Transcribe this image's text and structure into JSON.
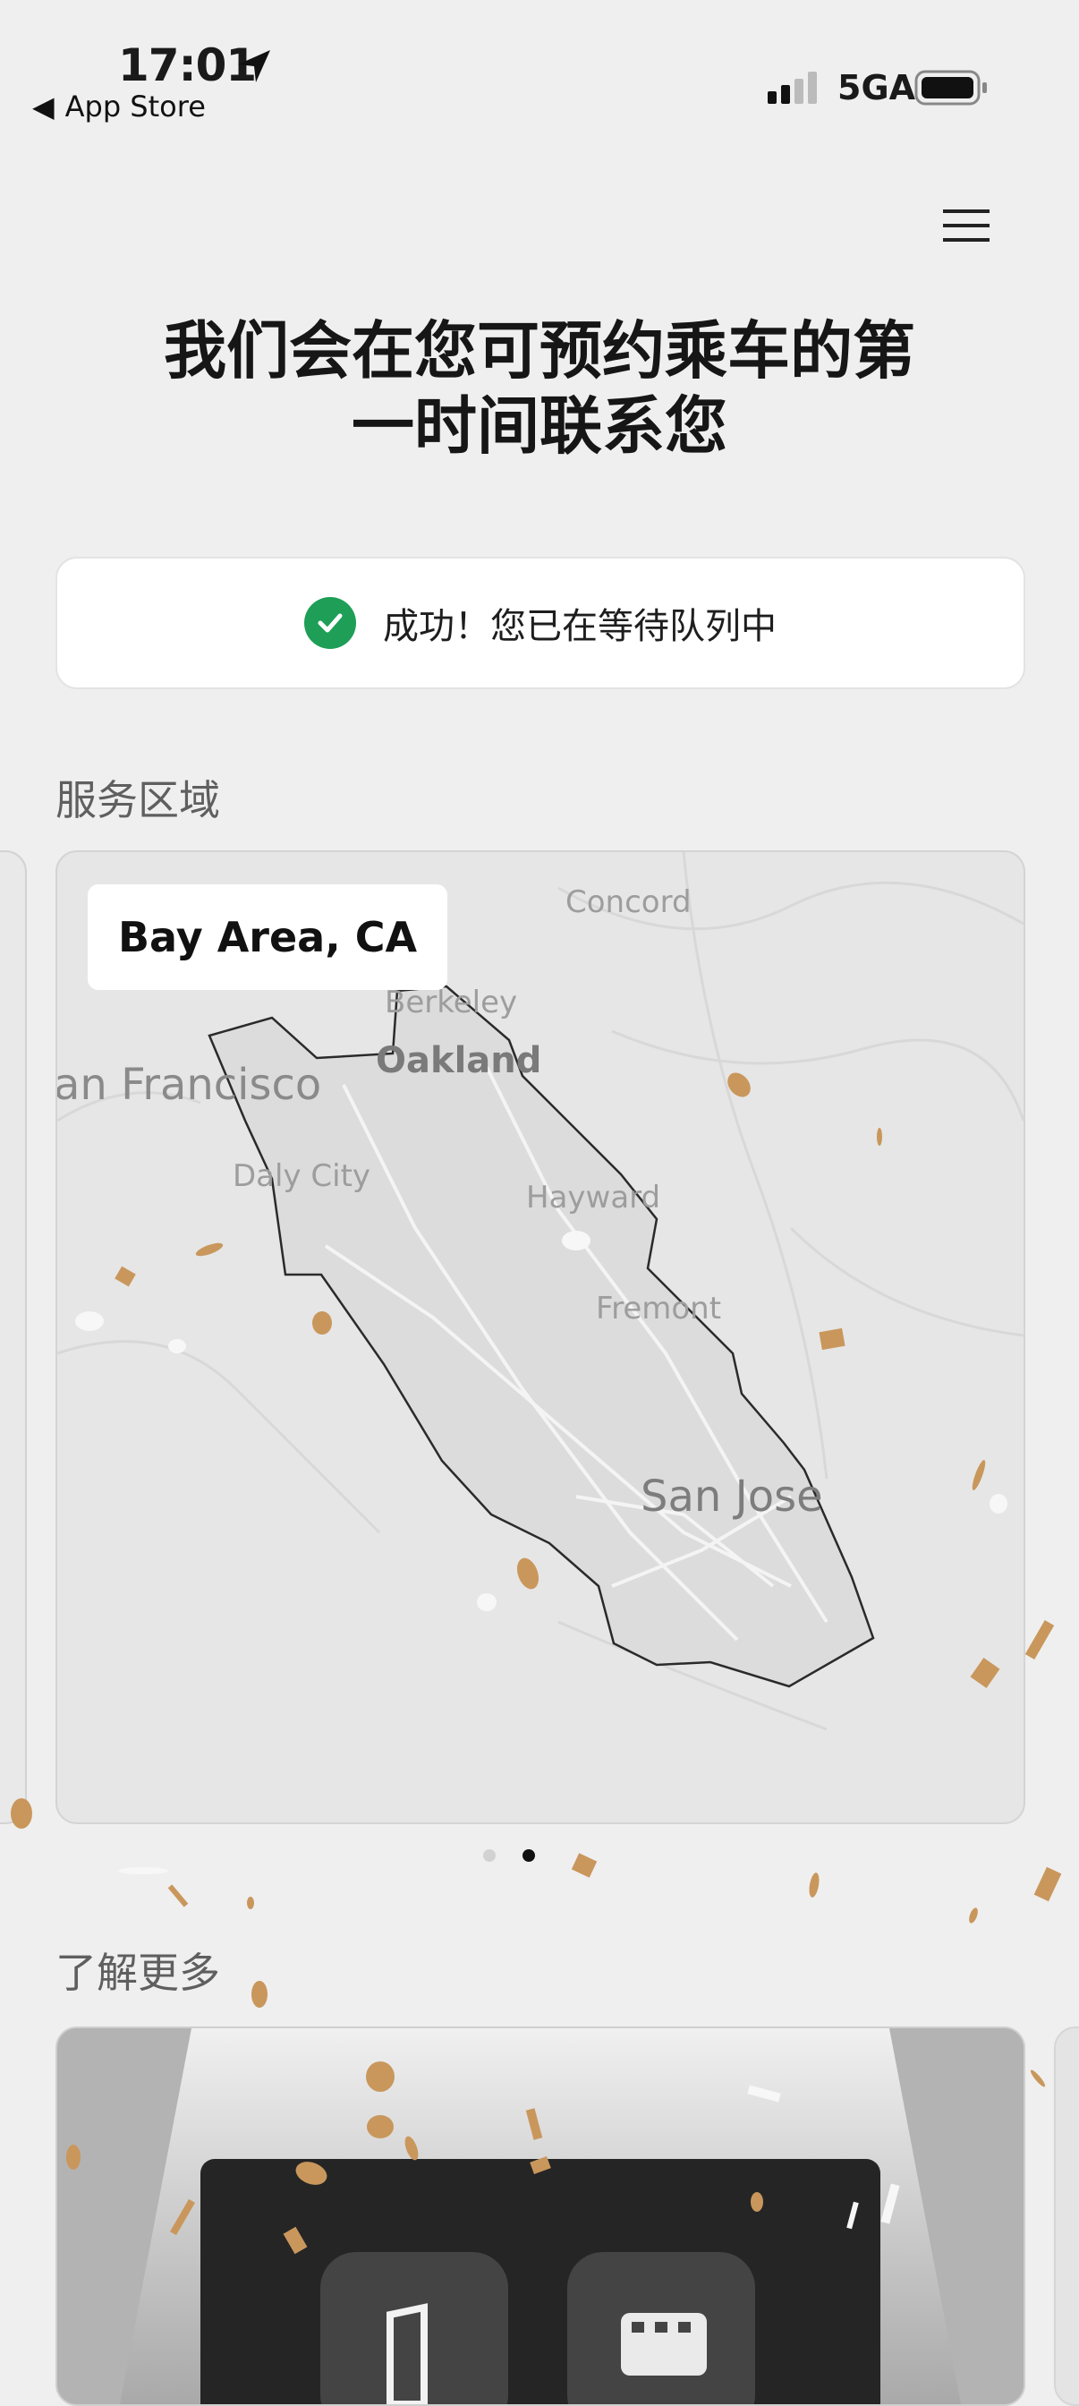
{
  "status_bar": {
    "time": "17:01",
    "back_label": "App Store",
    "network": "5GA"
  },
  "header": {
    "title_line1": "我们会在您可预约乘车的第",
    "title_line2": "一时间联系您"
  },
  "banner": {
    "message": "成功！您已在等待队列中",
    "status_color": "#1e9e57"
  },
  "service_area": {
    "section_title": "服务区域",
    "region_label": "Bay Area, CA",
    "cities": [
      "Concord",
      "Berkeley",
      "Oakland",
      "an Francisco",
      "Daly City",
      "Hayward",
      "Fremont",
      "San Jose"
    ],
    "pagination": {
      "total": 2,
      "active_index": 1
    }
  },
  "learn_more": {
    "section_title": "了解更多"
  }
}
